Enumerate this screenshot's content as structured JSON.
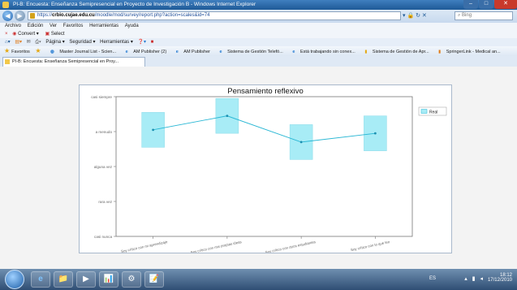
{
  "window": {
    "title": "PI-B: Encuesta: Enseñanza Semipresencial en Proyecto de Investigación B - Windows Internet Explorer",
    "controls": [
      "–",
      "□",
      "✕"
    ]
  },
  "nav": {
    "back": "◀",
    "forward": "▶",
    "url_prefix": "https://",
    "url_host": "crbio.cujae.edu.cu",
    "url_path": "/moodle/mod/survey/report.php?action=scales&id=74",
    "addr_buttons": "▾ 🔒 ↻ ✕",
    "search_placeholder": "Bing"
  },
  "menu": [
    "Archivo",
    "Edición",
    "Ver",
    "Favoritos",
    "Herramientas",
    "Ayuda"
  ],
  "convert": {
    "convert_label": "Convert",
    "select_label": "Select"
  },
  "commandbar": [
    "Página ▾",
    "Seguridad ▾",
    "Herramientas ▾"
  ],
  "favorites": {
    "label": "Favoritos",
    "items": [
      "Master Journal List - Scien...",
      "AM Publisher (2)",
      "AM Publisher",
      "Sistema de Gestión Telefó...",
      "Está trabajando sin conex...",
      "Sistema de Gestión de Apr...",
      "SpringerLink - Medical an..."
    ]
  },
  "tab": {
    "label": "PI-B: Encuesta: Enseñanza Semipresencial en Proy..."
  },
  "chart_data": {
    "type": "line",
    "title": "Pensamiento reflexivo",
    "categories": [
      "Soy crítico con mi aprendizaje",
      "Soy crítico con mis propias ideas",
      "Soy crítico con otros estudiantes",
      "Soy crítico con lo que leo"
    ],
    "y_tick_labels": [
      "casi nunca",
      "rara vez",
      "alguna vez",
      "a menudo",
      "casi siempre"
    ],
    "ylim": [
      1,
      5
    ],
    "series": [
      {
        "name": "Real",
        "values": [
          4.05,
          4.45,
          3.7,
          3.95
        ],
        "color": "#29b7d4",
        "box_color": "#a8ecf6"
      }
    ],
    "box_half_height": 0.5,
    "grid": false,
    "legend": "top-right"
  },
  "taskbar": {
    "apps": [
      "e",
      "📁",
      "▶",
      "📊",
      "⚙",
      "📝"
    ],
    "lang": "ES",
    "time": "18:12",
    "date": "17/12/2010"
  }
}
